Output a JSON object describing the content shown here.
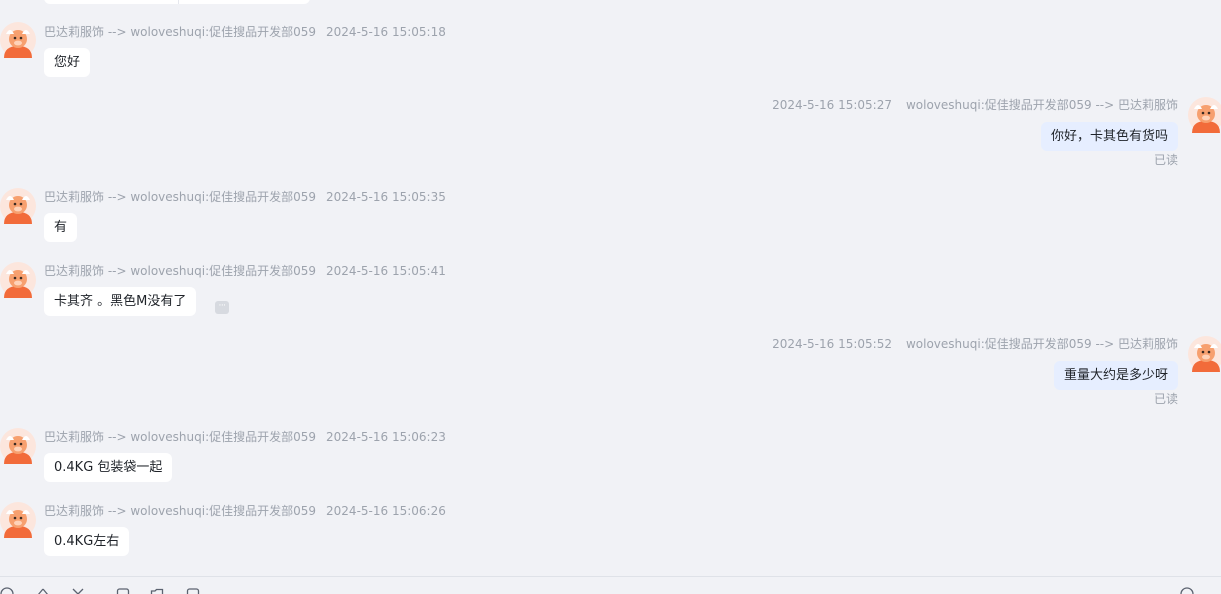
{
  "messages": [
    {
      "direction": "in",
      "sender": "巴达莉服饰 --> woloveshuqi:促佳搜品开发部059",
      "time": "2024-5-16 15:05:18",
      "text": "您好"
    },
    {
      "direction": "out",
      "sender": "woloveshuqi:促佳搜品开发部059 --> 巴达莉服饰",
      "time": "2024-5-16 15:05:27",
      "text": "你好，卡其色有货吗",
      "status": "已读"
    },
    {
      "direction": "in",
      "sender": "巴达莉服饰 --> woloveshuqi:促佳搜品开发部059",
      "time": "2024-5-16 15:05:35",
      "text": "有"
    },
    {
      "direction": "in",
      "sender": "巴达莉服饰 --> woloveshuqi:促佳搜品开发部059",
      "time": "2024-5-16 15:05:41",
      "text": "卡其齐 。黑色M没有了",
      "more": "···"
    },
    {
      "direction": "out",
      "sender": "woloveshuqi:促佳搜品开发部059 --> 巴达莉服饰",
      "time": "2024-5-16 15:05:52",
      "text": "重量大约是多少呀",
      "status": "已读"
    },
    {
      "direction": "in",
      "sender": "巴达莉服饰 --> woloveshuqi:促佳搜品开发部059",
      "time": "2024-5-16 15:06:23",
      "text": "0.4KG 包装袋一起"
    },
    {
      "direction": "in",
      "sender": "巴达莉服饰 --> woloveshuqi:促佳搜品开发部059",
      "time": "2024-5-16 15:06:26",
      "text": "0.4KG左右"
    }
  ],
  "toolbar": {
    "icons": [
      "emoji-icon",
      "arrow-up-icon",
      "scissors-icon",
      "image-icon",
      "folder-icon",
      "chat-icon",
      "help-icon"
    ]
  },
  "colors": {
    "background": "#f1f2f6",
    "incoming_bubble": "#ffffff",
    "outgoing_bubble": "#e6eeff",
    "meta_text": "#9da3ad",
    "avatar_accent": "#f26b3a"
  }
}
